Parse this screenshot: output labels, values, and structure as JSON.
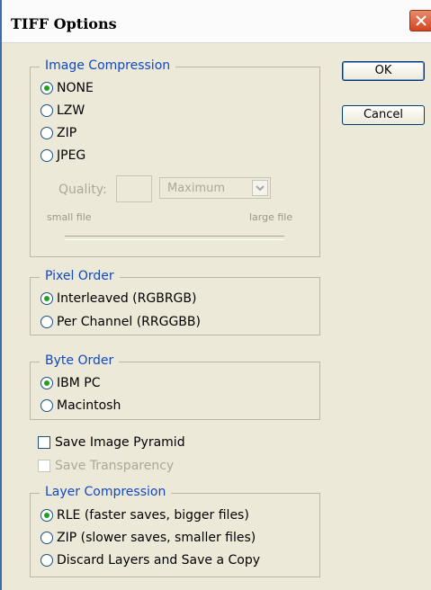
{
  "window": {
    "title": "TIFF Options"
  },
  "buttons": {
    "ok": "OK",
    "cancel": "Cancel"
  },
  "image_compression": {
    "legend": "Image Compression",
    "options": [
      "NONE",
      "LZW",
      "ZIP",
      "JPEG"
    ],
    "selected": "NONE",
    "quality_label": "Quality:",
    "quality_value": "",
    "quality_select": "Maximum",
    "small_file": "small file",
    "large_file": "large file"
  },
  "pixel_order": {
    "legend": "Pixel Order",
    "options": [
      "Interleaved (RGBRGB)",
      "Per Channel (RRGGBB)"
    ],
    "selected": "Interleaved (RGBRGB)"
  },
  "byte_order": {
    "legend": "Byte Order",
    "options": [
      "IBM PC",
      "Macintosh"
    ],
    "selected": "IBM PC"
  },
  "checkboxes": {
    "save_image_pyramid": "Save Image Pyramid",
    "save_transparency": "Save Transparency"
  },
  "layer_compression": {
    "legend": "Layer Compression",
    "options": [
      "RLE (faster saves, bigger files)",
      "ZIP (slower saves, smaller files)",
      "Discard Layers and Save a Copy"
    ],
    "selected": "RLE (faster saves, bigger files)"
  },
  "icons": {
    "close": "close-icon",
    "dropdown": "chevron-down-icon"
  },
  "colors": {
    "legend": "#0f48c8",
    "radio_dot": "#21a121",
    "close_button": "#d2451f"
  }
}
